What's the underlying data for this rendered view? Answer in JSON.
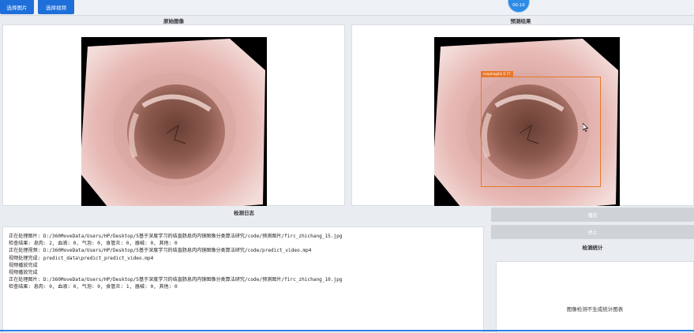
{
  "toolbar": {
    "select_image_label": "选择图片",
    "select_video_label": "选择视频",
    "timer_text": "00:16"
  },
  "original_panel": {
    "title": "原始图像"
  },
  "result_panel": {
    "title": "预测结果",
    "detection_label": "esophagitis 0.77",
    "detection_color": "#e8782a"
  },
  "log_panel": {
    "title": "检测日志",
    "lines": [
      "正在处理图片: D:/360MoveData/Users/HP/Desktop/5基于深度学习的结直肠息肉内镜图像分类算法研究/code/预测图片/firc_zhichang_15.jpg",
      "检查结果: 息肉: 2, 血液: 0, 气泡: 0, 食管炎: 0, 器械: 0, 其他: 0",
      "正在处理视频: D:/360MoveData/Users/HP/Desktop/5基于深度学习的结直肠息肉内镜图像分类算法研究/code/predict_video.mp4",
      "视频处理完成: predict_data\\predict_predict_video.mp4",
      "视频播放完成",
      "视频播放完成",
      "正在处理图片: D:/360MoveData/Users/HP/Desktop/5基于深度学习的结直肠息肉内镜图像分类算法研究/code/预测图片/firc_zhichang_10.jpg",
      "检查结果: 息肉: 0, 血液: 0, 气泡: 0, 食管炎: 1, 器械: 0, 其他: 0"
    ]
  },
  "side": {
    "btn1_label": "播放",
    "btn2_label": "停止",
    "stats_title": "检测统计",
    "stats_message": "图像检测不生成统计图表"
  },
  "colors": {
    "accent": "#1e6fd9",
    "bottom_accent": "#2f7fe0"
  }
}
